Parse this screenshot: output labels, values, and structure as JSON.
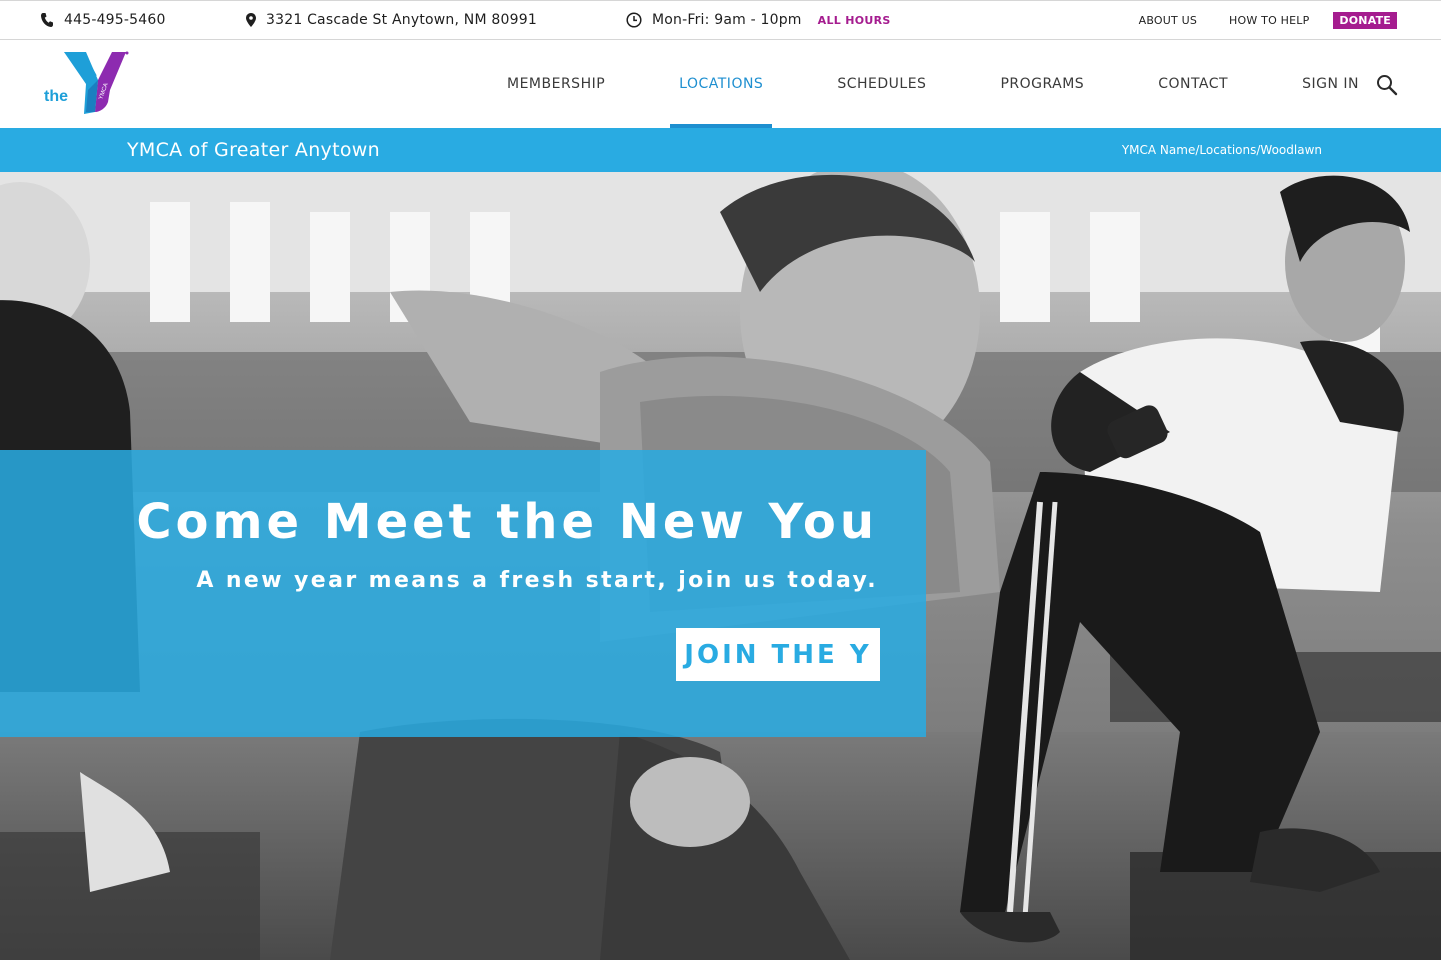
{
  "topbar": {
    "phone": "445-495-5460",
    "address": "3321 Cascade St Anytown, NM 80991",
    "hours": "Mon-Fri: 9am - 10pm",
    "all_hours_link": "ALL HOURS",
    "links": [
      "ABOUT US",
      "HOW TO HELP"
    ],
    "donate_label": "DONATE"
  },
  "logo": {
    "text": "the",
    "mark_text": "YMCA"
  },
  "nav": {
    "items": [
      {
        "label": "MEMBERSHIP",
        "active": false
      },
      {
        "label": "LOCATIONS",
        "active": true
      },
      {
        "label": "SCHEDULES",
        "active": false
      },
      {
        "label": "PROGRAMS",
        "active": false
      },
      {
        "label": "CONTACT",
        "active": false
      },
      {
        "label": "SIGN IN",
        "active": false
      }
    ]
  },
  "strip": {
    "site_title": "YMCA of Greater Anytown",
    "breadcrumb": "YMCA Name/Locations/Woodlawn"
  },
  "hero": {
    "headline": "Come Meet the New You",
    "subheadline": "A new year means a fresh start, join us today.",
    "cta_label": "JOIN THE Y"
  },
  "colors": {
    "brand_blue": "#29abe2",
    "nav_active": "#1e8fd0",
    "accent_purple": "#a51c8f"
  },
  "icons": [
    "phone-icon",
    "map-pin-icon",
    "clock-icon",
    "search-icon"
  ]
}
